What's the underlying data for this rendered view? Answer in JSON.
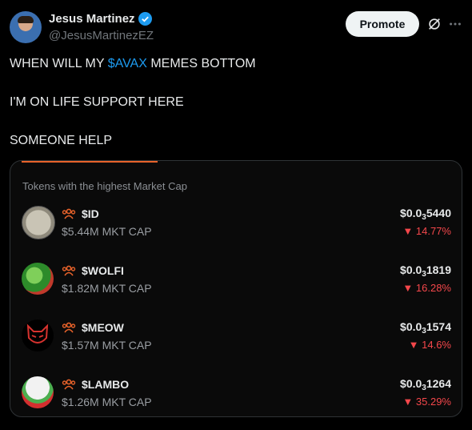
{
  "author": {
    "name": "Jesus Martinez",
    "handle": "@JesusMartinezEZ"
  },
  "actions": {
    "promote_label": "Promote"
  },
  "tweet": {
    "line1_before": "WHEN WILL MY ",
    "line1_cashtag": "$AVAX",
    "line1_after": " MEMES BOTTOM",
    "line2": "I'M ON LIFE SUPPORT HERE",
    "line3": "SOMEONE HELP"
  },
  "card": {
    "title": "Tokens with the highest Market Cap",
    "accent": "#e7622a",
    "tokens": [
      {
        "symbol": "$ID",
        "mcap": "$5.44M MKT CAP",
        "price_prefix": "$0.0",
        "price_zeros": "3",
        "price_digits": "5440",
        "change": "▼ 14.77%"
      },
      {
        "symbol": "$WOLFI",
        "mcap": "$1.82M MKT CAP",
        "price_prefix": "$0.0",
        "price_zeros": "3",
        "price_digits": "1819",
        "change": "▼ 16.28%"
      },
      {
        "symbol": "$MEOW",
        "mcap": "$1.57M MKT CAP",
        "price_prefix": "$0.0",
        "price_zeros": "3",
        "price_digits": "1574",
        "change": "▼ 14.6%"
      },
      {
        "symbol": "$LAMBO",
        "mcap": "$1.26M MKT CAP",
        "price_prefix": "$0.0",
        "price_zeros": "3",
        "price_digits": "1264",
        "change": "▼ 35.29%"
      }
    ]
  },
  "colors": {
    "cashtag": "#1d9bf0",
    "verified": "#1d9bf0",
    "down": "#f4474b"
  }
}
